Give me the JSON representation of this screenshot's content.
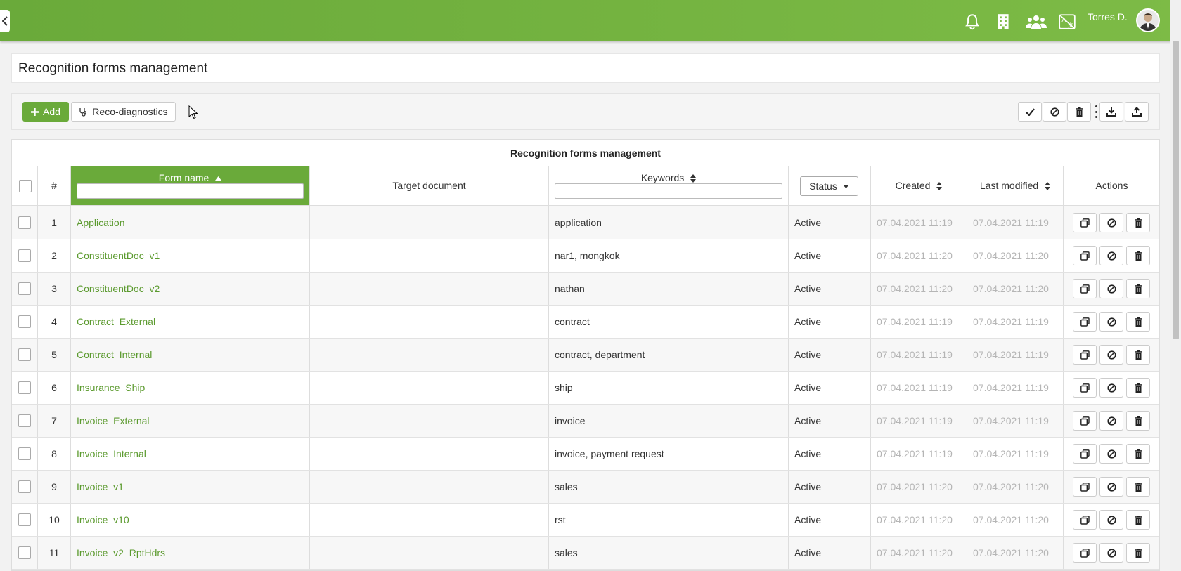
{
  "header": {
    "user_name": "Torres D.",
    "icons": [
      "bell-icon",
      "building-icon",
      "users-icon",
      "translate-icon"
    ]
  },
  "page": {
    "title": "Recognition forms management"
  },
  "toolbar": {
    "add_label": "Add",
    "reco_label": "Reco-diagnostics"
  },
  "table": {
    "caption": "Recognition forms management",
    "columns": {
      "num": "#",
      "form_name": "Form name",
      "target_document": "Target document",
      "keywords": "Keywords",
      "status": "Status",
      "created": "Created",
      "last_modified": "Last modified",
      "actions": "Actions"
    },
    "rows": [
      {
        "num": "1",
        "form_name": "Application",
        "target": "",
        "keywords": "application",
        "status": "Active",
        "created": "07.04.2021 11:19",
        "modified": "07.04.2021 11:19"
      },
      {
        "num": "2",
        "form_name": "ConstituentDoc_v1",
        "target": "",
        "keywords": "nar1, mongkok",
        "status": "Active",
        "created": "07.04.2021 11:20",
        "modified": "07.04.2021 11:20"
      },
      {
        "num": "3",
        "form_name": "ConstituentDoc_v2",
        "target": "",
        "keywords": "nathan",
        "status": "Active",
        "created": "07.04.2021 11:20",
        "modified": "07.04.2021 11:20"
      },
      {
        "num": "4",
        "form_name": "Contract_External",
        "target": "",
        "keywords": "contract",
        "status": "Active",
        "created": "07.04.2021 11:19",
        "modified": "07.04.2021 11:19"
      },
      {
        "num": "5",
        "form_name": "Contract_Internal",
        "target": "",
        "keywords": "contract, department",
        "status": "Active",
        "created": "07.04.2021 11:19",
        "modified": "07.04.2021 11:19"
      },
      {
        "num": "6",
        "form_name": "Insurance_Ship",
        "target": "",
        "keywords": "ship",
        "status": "Active",
        "created": "07.04.2021 11:19",
        "modified": "07.04.2021 11:19"
      },
      {
        "num": "7",
        "form_name": "Invoice_External",
        "target": "",
        "keywords": "invoice",
        "status": "Active",
        "created": "07.04.2021 11:19",
        "modified": "07.04.2021 11:19"
      },
      {
        "num": "8",
        "form_name": "Invoice_Internal",
        "target": "",
        "keywords": "invoice, payment request",
        "status": "Active",
        "created": "07.04.2021 11:19",
        "modified": "07.04.2021 11:19"
      },
      {
        "num": "9",
        "form_name": "Invoice_v1",
        "target": "",
        "keywords": "sales",
        "status": "Active",
        "created": "07.04.2021 11:20",
        "modified": "07.04.2021 11:20"
      },
      {
        "num": "10",
        "form_name": "Invoice_v10",
        "target": "",
        "keywords": "rst",
        "status": "Active",
        "created": "07.04.2021 11:20",
        "modified": "07.04.2021 11:20"
      },
      {
        "num": "11",
        "form_name": "Invoice_v2_RptHdrs",
        "target": "",
        "keywords": "sales",
        "status": "Active",
        "created": "07.04.2021 11:20",
        "modified": "07.04.2021 11:20"
      }
    ]
  },
  "colors": {
    "accent": "#6aaa3a",
    "link": "#5b9a2e",
    "date": "#b5b5b5"
  }
}
